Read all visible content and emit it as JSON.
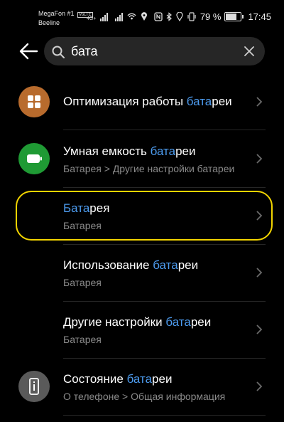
{
  "status_bar": {
    "carrier_line1": "MegaFon #1",
    "volte_badge": "VoLTE",
    "network_badge": "4G+",
    "carrier_line2": "Beeline",
    "battery_percent": "79 %",
    "time": "17:45"
  },
  "search": {
    "query": "бата"
  },
  "results": [
    {
      "title_pre": "Оптимизация работы ",
      "title_hl": "бата",
      "title_post": "реи",
      "subtitle": "",
      "icon": "grid-icon",
      "icon_color": "#b86b2d"
    },
    {
      "title_pre": "Умная емкость ",
      "title_hl": "бата",
      "title_post": "реи",
      "subtitle": "Батарея > Другие настройки батареи",
      "icon": "battery-icon",
      "icon_color": "#1f9a34"
    },
    {
      "title_pre": "",
      "title_hl": "Бата",
      "title_post": "рея",
      "subtitle": "Батарея",
      "icon": "",
      "icon_color": ""
    },
    {
      "title_pre": "Использование ",
      "title_hl": "бата",
      "title_post": "реи",
      "subtitle": "Батарея",
      "icon": "",
      "icon_color": ""
    },
    {
      "title_pre": "Другие настройки ",
      "title_hl": "бата",
      "title_post": "реи",
      "subtitle": "Батарея",
      "icon": "",
      "icon_color": ""
    },
    {
      "title_pre": "Состояние ",
      "title_hl": "бата",
      "title_post": "реи",
      "subtitle": "О телефоне > Общая информация",
      "icon": "phone-info-icon",
      "icon_color": "#5a5a5a"
    }
  ],
  "colors": {
    "highlight": "#4d9cf0",
    "focus_ring": "#f2d400",
    "background": "#000000"
  }
}
